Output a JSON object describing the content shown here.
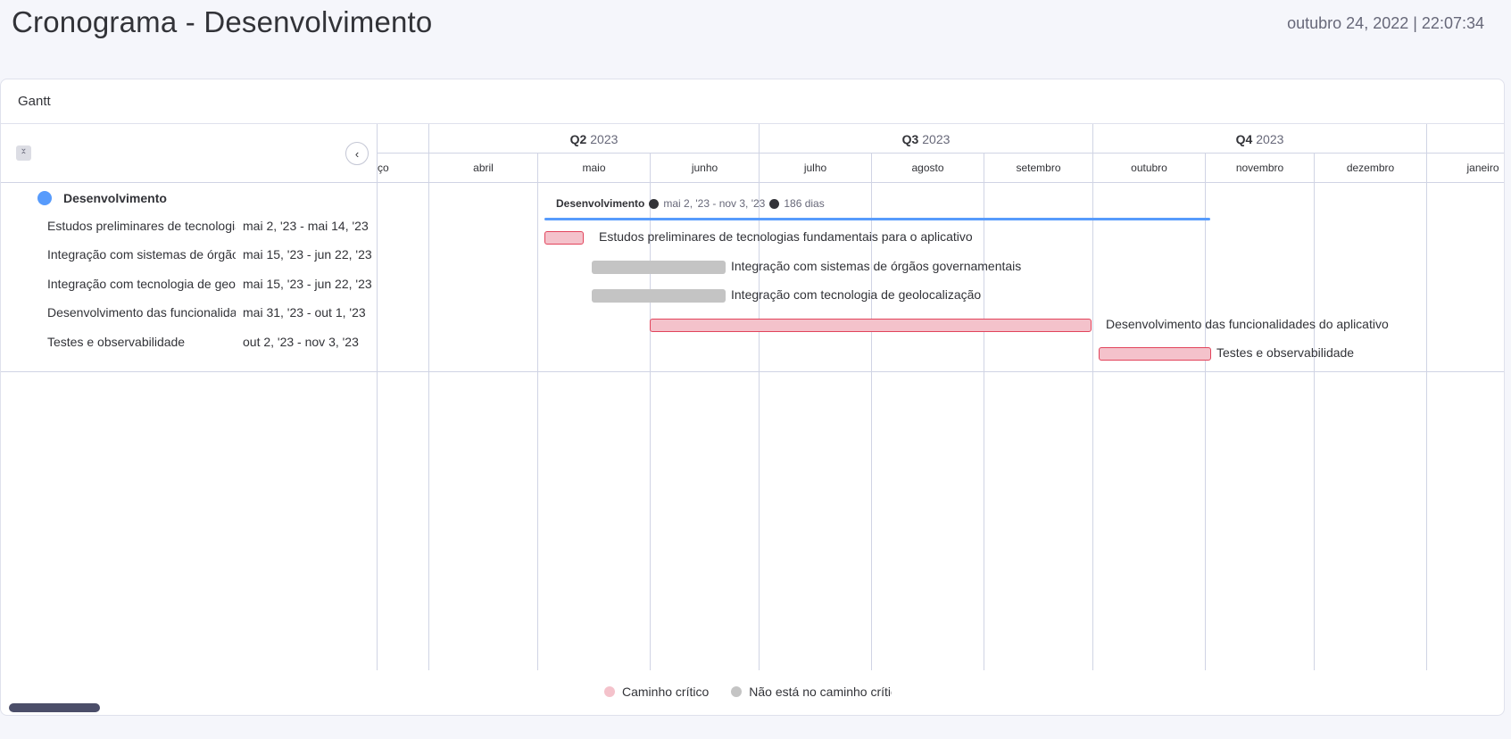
{
  "page": {
    "title": "Cronograma - Desenvolvimento",
    "timestamp": "outubro 24, 2022 | 22:07:34"
  },
  "card": {
    "title": "Gantt"
  },
  "timeline": {
    "quarters": [
      {
        "q": "",
        "year": ""
      },
      {
        "q": "Q2",
        "year": "2023"
      },
      {
        "q": "Q3",
        "year": "2023"
      },
      {
        "q": "Q4",
        "year": "2023"
      },
      {
        "q": "",
        "year": ""
      }
    ],
    "months": [
      "ço",
      "abril",
      "maio",
      "junho",
      "julho",
      "agosto",
      "setembro",
      "outubro",
      "novembro",
      "dezembro",
      "janeiro"
    ]
  },
  "group": {
    "name": "Desenvolvimento",
    "dates": "mai 2, '23 - nov 3, '23",
    "duration": "186 dias",
    "color": "#579bfc"
  },
  "tasks": [
    {
      "name": "Estudos preliminares de tecnologias fundamentais para o aplicativo",
      "dates": "mai 2, '23 - mai 14, '23",
      "critical": true
    },
    {
      "name": "Integração com sistemas de órgãos governamentais",
      "dates": "mai 15, '23 - jun 22, '23",
      "critical": false
    },
    {
      "name": "Integração com tecnologia de geolocalização",
      "dates": "mai 15, '23 - jun 22, '23",
      "critical": false
    },
    {
      "name": "Desenvolvimento das funcionalidades do aplicativo",
      "dates": "mai 31, '23 - out 1, '23",
      "critical": true
    },
    {
      "name": "Testes e observabilidade",
      "dates": "out 2, '23 - nov 3, '23",
      "critical": true
    }
  ],
  "legend": {
    "critical": "Caminho crítico",
    "non_critical": "Não está no caminho crítico",
    "critical_color": "#f4c2cb",
    "non_critical_color": "#c4c4c4"
  },
  "colors": {
    "critical_border": "#e2445c",
    "accent": "#579bfc"
  }
}
